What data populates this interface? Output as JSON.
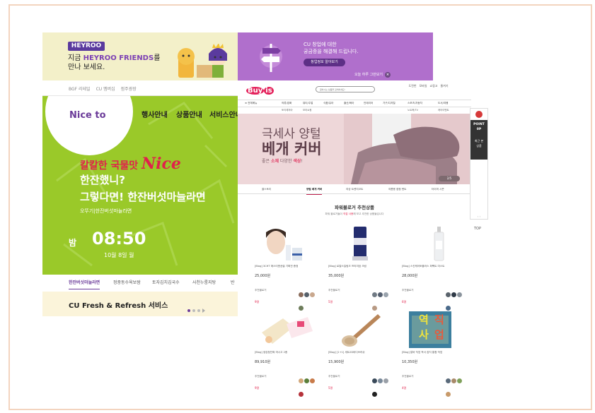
{
  "cu": {
    "banner": {
      "logo": "HEYROO",
      "line1_prefix": "지금 ",
      "line1_highlight": "HEYROO FRIENDS",
      "line1_suffix": "를",
      "line2": "만나 보세요."
    },
    "links": [
      "BGF 리테일",
      "CU 멤버십",
      "점주광장"
    ],
    "logo": "Nice to",
    "nav": [
      "행사안내",
      "상품안내",
      "서비스안내"
    ],
    "promo": {
      "sub_text": "칼칼한 국물맛 ",
      "sub_script": "Nice",
      "line1": "한잔했니?",
      "line2": "그렇다면! 한잔버섯마늘라면",
      "brand": "오뚜기|한잔버섯마늘라면"
    },
    "time": {
      "label": "밤",
      "value": "08:50",
      "date": "10월 8일 월"
    },
    "tabs": [
      "한잔버섯마늘라면",
      "정중동수육보쌈",
      "토자김치김국수",
      "사천누룽지탕",
      "반"
    ],
    "fresh": "CU Fresh & Refresh 서비스"
  },
  "cu_ad": {
    "line1": "CU 창업에 대한",
    "line2": "궁금증을 해결해 드립니다.",
    "button": "창업정보 알아보기",
    "close_text": "오늘 하루 그만보기",
    "close_glyph": "×"
  },
  "buyis": {
    "logo_text": "Buy",
    "logo_badge": "is",
    "search_placeholder": "원하시는 상품을 검색하세요!",
    "utils": [
      "도전번",
      "모바일",
      "쇼핑고",
      "줄겨기"
    ],
    "utils_sub": [
      "날고",
      "묶지",
      "최저가",
      "도전"
    ],
    "cats": [
      "≡ 전체메뉴",
      "의류/잡화",
      "뷰티/주얼",
      "식품/유아",
      "출산/육아",
      "인테리어",
      "가구/디지털",
      "스포츠/자동차",
      "도서/여행"
    ],
    "subcats": [
      "토이레저아",
      "모라쇼핑",
      "",
      "",
      "",
      "",
      "",
      "노트북/TV",
      "캐어이벤트"
    ],
    "hero": {
      "line1": "극세사 양털",
      "line2": "베개 커버",
      "line3_a": "좋은 ",
      "line3_em1": "소재",
      "line3_b": " 다양한 ",
      "line3_em2": "색상",
      "line3_c": "!",
      "pager": "2/5"
    },
    "hero_tabs": [
      "쿨스토리",
      "양털 베개 커버",
      "여성 트렌치코트",
      "여름용 캠핑 텐트",
      "타이머 시즌"
    ],
    "section_title": "파워블로거 추천상품",
    "section_sub_a": "파워 블로거들이 ",
    "section_sub_em": "직접 사용",
    "section_sub_b": "해 보고 추천한 상품들입니다",
    "products": [
      {
        "name": "[Blog] 3CHT 에스티엔센셜 기획전 증정",
        "price": "25,000원",
        "rec": "추천블로거",
        "count": "9명"
      },
      {
        "name": "[Blog] 로얄스킬링크 프리미엄 크림",
        "price": "35,000원",
        "rec": "추천블로거",
        "count": "5명"
      },
      {
        "name": "[Blog] 스킨케어토플러스 퍼펙트 미스트",
        "price": "28,000원",
        "rec": "추천블로거",
        "count": "6명"
      },
      {
        "name": "[Blog] 생강청진짜 마시고 2종",
        "price": "89,910원",
        "rec": "추천블로거",
        "count": "9명"
      },
      {
        "name": "[Blog] [1+1] 세트2D바디브러쉬",
        "price": "15,900원",
        "rec": "추천블로거",
        "count": "5명"
      },
      {
        "name": "[Blog] 알바 직업 독서 잡지 통합 작업",
        "price": "10,350원",
        "rec": "추천블로거",
        "count": "4명"
      }
    ],
    "book_letters": [
      "역",
      "사",
      "직",
      "업"
    ]
  },
  "rail": {
    "point_1": "POINT",
    "point_2": "0P",
    "recent_1": "최근 본",
    "recent_2": "상품",
    "arrows": "‹ ›",
    "top": "TOP"
  },
  "colors": {
    "cu_purple": "#6b3b99",
    "cu_green": "#9ac929",
    "promo_red": "#e0214b",
    "ad_purple": "#b06fcc",
    "hero_pink": "#eed7d9",
    "frame_border": "#f3d4bf"
  },
  "icons": [
    "heyroo-characters",
    "signpost-icon",
    "search-icon",
    "close-icon",
    "chevron-right-icon",
    "point-icon"
  ]
}
